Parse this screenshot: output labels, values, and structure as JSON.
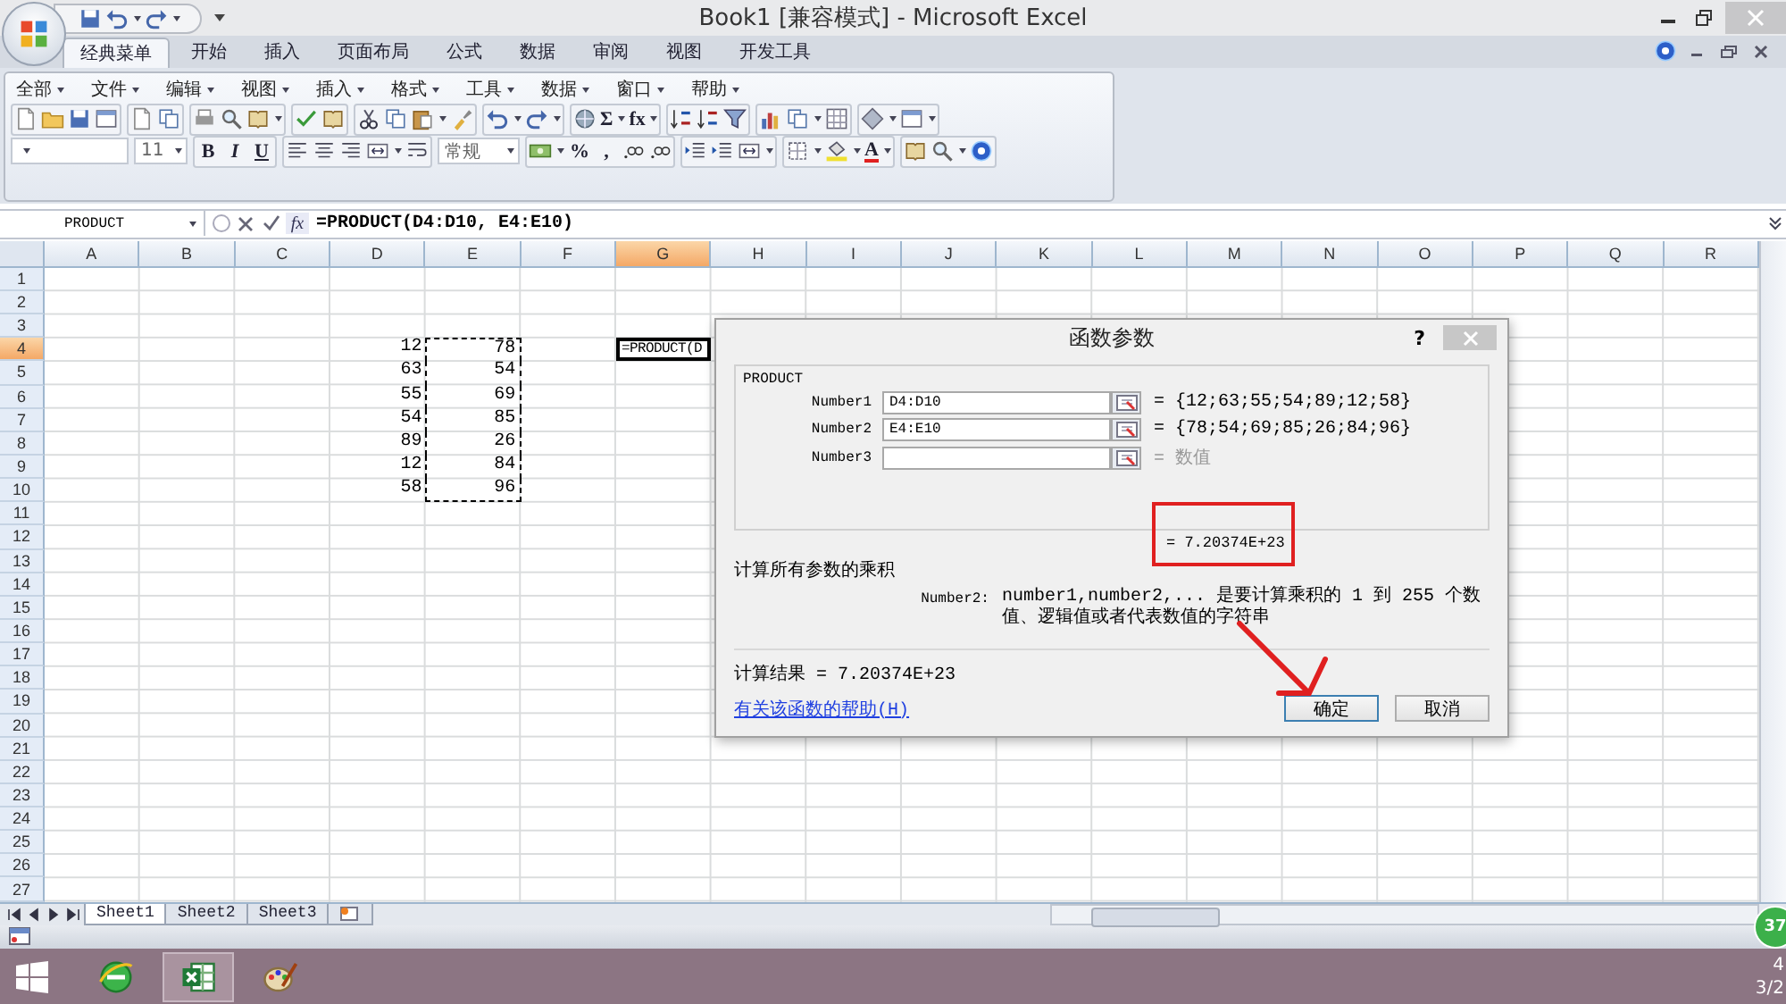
{
  "window": {
    "title": "Book1  [兼容模式] - Microsoft Excel"
  },
  "ribbon_tabs": [
    {
      "label": "经典菜单",
      "selected": true
    },
    {
      "label": "开始",
      "selected": false
    },
    {
      "label": "插入",
      "selected": false
    },
    {
      "label": "页面布局",
      "selected": false
    },
    {
      "label": "公式",
      "selected": false
    },
    {
      "label": "数据",
      "selected": false
    },
    {
      "label": "审阅",
      "selected": false
    },
    {
      "label": "视图",
      "selected": false
    },
    {
      "label": "开发工具",
      "selected": false
    }
  ],
  "classic_menu": [
    "全部",
    "文件",
    "编辑",
    "视图",
    "插入",
    "格式",
    "工具",
    "数据",
    "窗口",
    "帮助"
  ],
  "toolbar": {
    "sum": "Σ",
    "function": "fx",
    "font_size": "11",
    "bold": "B",
    "italic": "I",
    "underline": "U",
    "number_format": "常规",
    "percent": "%",
    "comma": ",",
    "font_color": "A"
  },
  "formula_bar": {
    "name_box": "PRODUCT",
    "fx": "fx",
    "formula": "=PRODUCT(D4:D10, E4:E10)"
  },
  "columns": [
    {
      "label": "A",
      "selected": false
    },
    {
      "label": "B",
      "selected": false
    },
    {
      "label": "C",
      "selected": false
    },
    {
      "label": "D",
      "selected": false
    },
    {
      "label": "E",
      "selected": false
    },
    {
      "label": "F",
      "selected": false
    },
    {
      "label": "G",
      "selected": true
    },
    {
      "label": "H",
      "selected": false
    },
    {
      "label": "I",
      "selected": false
    },
    {
      "label": "J",
      "selected": false
    },
    {
      "label": "K",
      "selected": false
    },
    {
      "label": "L",
      "selected": false
    },
    {
      "label": "M",
      "selected": false
    },
    {
      "label": "N",
      "selected": false
    },
    {
      "label": "O",
      "selected": false
    },
    {
      "label": "P",
      "selected": false
    },
    {
      "label": "Q",
      "selected": false
    },
    {
      "label": "R",
      "selected": false
    }
  ],
  "rows": [
    {
      "label": "1",
      "selected": false
    },
    {
      "label": "2",
      "selected": false
    },
    {
      "label": "3",
      "selected": false
    },
    {
      "label": "4",
      "selected": true,
      "cells": [
        null,
        null,
        null,
        {
          "kind": "number",
          "value": "12"
        },
        {
          "kind": "number",
          "value": "78",
          "marquee": true
        },
        null,
        {
          "kind": "formula",
          "value": "=PRODUCT(D",
          "active": true
        }
      ]
    },
    {
      "label": "5",
      "selected": false,
      "cells": [
        null,
        null,
        null,
        {
          "kind": "number",
          "value": "63"
        },
        {
          "kind": "number",
          "value": "54",
          "marquee": true
        }
      ]
    },
    {
      "label": "6",
      "selected": false,
      "cells": [
        null,
        null,
        null,
        {
          "kind": "number",
          "value": "55"
        },
        {
          "kind": "number",
          "value": "69",
          "marquee": true
        }
      ]
    },
    {
      "label": "7",
      "selected": false,
      "cells": [
        null,
        null,
        null,
        {
          "kind": "number",
          "value": "54"
        },
        {
          "kind": "number",
          "value": "85",
          "marquee": true
        }
      ]
    },
    {
      "label": "8",
      "selected": false,
      "cells": [
        null,
        null,
        null,
        {
          "kind": "number",
          "value": "89"
        },
        {
          "kind": "number",
          "value": "26",
          "marquee": true
        }
      ]
    },
    {
      "label": "9",
      "selected": false,
      "cells": [
        null,
        null,
        null,
        {
          "kind": "number",
          "value": "12"
        },
        {
          "kind": "number",
          "value": "84",
          "marquee": true
        }
      ]
    },
    {
      "label": "10",
      "selected": false,
      "cells": [
        null,
        null,
        null,
        {
          "kind": "number",
          "value": "58"
        },
        {
          "kind": "number",
          "value": "96",
          "marquee": true
        }
      ]
    },
    {
      "label": "11",
      "selected": false
    },
    {
      "label": "12",
      "selected": false
    },
    {
      "label": "13",
      "selected": false
    },
    {
      "label": "14",
      "selected": false
    },
    {
      "label": "15",
      "selected": false
    },
    {
      "label": "16",
      "selected": false
    },
    {
      "label": "17",
      "selected": false
    },
    {
      "label": "18",
      "selected": false
    },
    {
      "label": "19",
      "selected": false
    },
    {
      "label": "20",
      "selected": false
    },
    {
      "label": "21",
      "selected": false
    },
    {
      "label": "22",
      "selected": false
    },
    {
      "label": "23",
      "selected": false
    },
    {
      "label": "24",
      "selected": false
    },
    {
      "label": "25",
      "selected": false
    },
    {
      "label": "26",
      "selected": false
    },
    {
      "label": "27",
      "selected": false
    }
  ],
  "sheet_tabs": [
    {
      "label": "Sheet1",
      "selected": true
    },
    {
      "label": "Sheet2",
      "selected": false
    },
    {
      "label": "Sheet3",
      "selected": false
    }
  ],
  "dialog": {
    "title": "函数参数",
    "help_button": "?",
    "group": "PRODUCT",
    "arguments": [
      {
        "label": "Number1",
        "value": "D4:D10",
        "result": "= {12;63;55;54;89;12;58}",
        "muted": false
      },
      {
        "label": "Number2",
        "value": "E4:E10",
        "result": "= {78;54;69;85;26;84;96}",
        "muted": false
      },
      {
        "label": "Number3",
        "result": "= 数值",
        "muted": true
      }
    ],
    "formula_result": "= 7.20374E+23",
    "description": "计算所有参数的乘积",
    "argument_help": {
      "label": "Number2:",
      "text": "number1,number2,...  是要计算乘积的 1 到 255 个数值、逻辑值或者代表数值的字符串"
    },
    "result_line": "计算结果 = 7.20374E+23",
    "help_link": "有关该函数的帮助(H)",
    "buttons": [
      {
        "label": "确定",
        "default": true
      },
      {
        "label": "取消",
        "default": false
      }
    ]
  },
  "taskbar": {
    "apps": [
      {
        "kind": "browser",
        "selected": false
      },
      {
        "kind": "spreadsheet",
        "selected": true
      },
      {
        "kind": "paint",
        "selected": false
      }
    ],
    "clock": [
      "4",
      "3/2"
    ]
  },
  "badge": "37"
}
